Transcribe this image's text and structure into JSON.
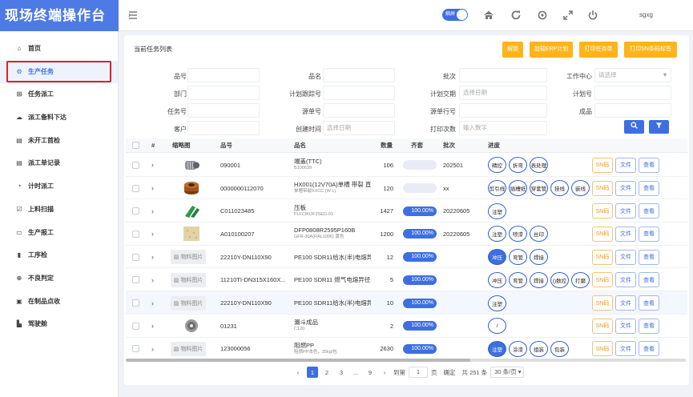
{
  "app": {
    "title": "现场终端操作台",
    "toggle_label": "触屏",
    "user": "sgxg"
  },
  "sidebar": {
    "items": [
      {
        "label": "首页",
        "icon": "home-icon",
        "glyph": "⌂"
      },
      {
        "label": "生产任务",
        "icon": "gears-icon",
        "glyph": "⚙"
      },
      {
        "label": "任务派工",
        "icon": "org-chart-icon",
        "glyph": "⊞"
      },
      {
        "label": "派工备料下达",
        "icon": "cloud-download-icon",
        "glyph": "☁"
      },
      {
        "label": "未开工首检",
        "icon": "id-card-icon",
        "glyph": "▤"
      },
      {
        "label": "派工单记录",
        "icon": "id-card-icon",
        "glyph": "▤"
      },
      {
        "label": "计时派工",
        "icon": "clock-icon",
        "glyph": "◔"
      },
      {
        "label": "上料扫描",
        "icon": "check-square-icon",
        "glyph": "☑"
      },
      {
        "label": "生产报工",
        "icon": "file-icon",
        "glyph": "▭"
      },
      {
        "label": "工序检",
        "icon": "database-icon",
        "glyph": "▮"
      },
      {
        "label": "不良判定",
        "icon": "search-plus-icon",
        "glyph": "⊕"
      },
      {
        "label": "在制品点收",
        "icon": "inbox-icon",
        "glyph": "▣"
      },
      {
        "label": "驾驶舱",
        "icon": "chart-icon",
        "glyph": "▙"
      }
    ]
  },
  "panel": {
    "title": "当前任务列表",
    "buttons": [
      "解锁",
      "加载ERP计划",
      "打印任务单",
      "打印SN条码标签"
    ],
    "filters": {
      "pinhao": "品号",
      "pinming": "品名",
      "pici": "批次",
      "gongzuozhongxin": "工作中心",
      "gongzuozhongxin_ph": "请选择",
      "bumen": "部门",
      "jihuagenzonghao": "计划跟踪号",
      "jihuajiaoqi": "计划交期",
      "jihuajiaoqi_ph": "选择日期",
      "jihuahao": "计划号",
      "renwuhao": "任务号",
      "yuandanhao": "源单号",
      "yuandanhanghao": "源单行号",
      "chengpin": "成品",
      "kehu": "客户",
      "chuangjianshijian": "创建时间",
      "chuangjianshijian_ph": "选择日期",
      "dayincishu": "打印次数",
      "dayincishu_ph": "输入数字"
    }
  },
  "table": {
    "headers": [
      "#",
      "缩略图",
      "品号",
      "品名",
      "数量",
      "齐套",
      "批次",
      "进度"
    ],
    "rows": [
      {
        "code": "090001",
        "name": "端盖(TTC)",
        "sub": "B100639",
        "qty": "106",
        "kit": "",
        "kit_pct": 0,
        "batch": "202501",
        "steps": [
          {
            "t": "精控",
            "d": false
          },
          {
            "t": "折弯",
            "d": false
          },
          {
            "t": "表处理",
            "d": false
          }
        ],
        "img": "motor",
        "ph": ""
      },
      {
        "code": "0000000112070",
        "name": "HX001(12V70A)单槽 带裂 直月",
        "sub": "单槽带裂XXCC (W L)",
        "qty": "120",
        "kit": "",
        "kit_pct": 0,
        "batch": "xx",
        "steps": [
          {
            "t": "剪引线",
            "d": false
          },
          {
            "t": "插槽纸",
            "d": false
          },
          {
            "t": "穿套管",
            "d": false
          },
          {
            "t": "挂线",
            "d": false
          },
          {
            "t": "嵌线",
            "d": false
          }
        ],
        "img": "coil",
        "ph": ""
      },
      {
        "code": "C011023485",
        "name": "压板",
        "sub": "FLFCIKOF2SED-01",
        "qty": "1427",
        "kit": "100.00%",
        "kit_pct": 100,
        "batch": "20220605",
        "steps": [
          {
            "t": "注塑",
            "d": false
          }
        ],
        "img": "green",
        "ph": ""
      },
      {
        "code": "A010100207",
        "name": "DFP0808R2595P160B",
        "sub": "GFR-30A(RAL1006) 黄色",
        "qty": "1200",
        "kit": "100.00%",
        "kit_pct": 100,
        "batch": "20220605",
        "steps": [
          {
            "t": "注塑",
            "d": false
          },
          {
            "t": "喷漆",
            "d": false
          },
          {
            "t": "丝印",
            "d": false
          }
        ],
        "img": "beige",
        "ph": ""
      },
      {
        "code": "22210Y-DN110X90",
        "name": "PE100 SDR11给水(半)电熔异径",
        "sub": "",
        "qty": "12",
        "kit": "100.00%",
        "kit_pct": 100,
        "batch": "",
        "steps": [
          {
            "t": "冲压",
            "d": true
          },
          {
            "t": "弯管",
            "d": false
          },
          {
            "t": "焊接",
            "d": false
          }
        ],
        "img": "",
        "ph": "物料图片"
      },
      {
        "code": "11210TI-DN315X160X...",
        "name": "PE100 SDR11 燃气电熔异径三通",
        "sub": "",
        "qty": "5",
        "kit": "100.00%",
        "kit_pct": 100,
        "batch": "",
        "steps": [
          {
            "t": "冲压",
            "d": false
          },
          {
            "t": "弯管",
            "d": false
          },
          {
            "t": "焊接",
            "d": false
          },
          {
            "t": "()数控",
            "d": false
          },
          {
            "t": "打磨",
            "d": false
          }
        ],
        "img": "",
        "ph": "物料图片"
      },
      {
        "code": "22210Y-DN110X90",
        "name": "PE100 SDR11给水(半)电熔异径",
        "sub": "",
        "qty": "10",
        "kit": "100.00%",
        "kit_pct": 100,
        "batch": "",
        "steps": [
          {
            "t": "注塑",
            "d": false
          }
        ],
        "img": "",
        "ph": "物料图片"
      },
      {
        "code": "01231",
        "name": "漏斗成品",
        "sub": "C120",
        "qty": "2",
        "kit": "100.00%",
        "kit_pct": 100,
        "batch": "",
        "steps": [
          {
            "t": "/",
            "d": false
          }
        ],
        "img": "gear",
        "ph": ""
      },
      {
        "code": "123000056",
        "name": "阻燃PP",
        "sub": "阻燃PP本色，25kg/包",
        "qty": "2630",
        "kit": "100.00%",
        "kit_pct": 100,
        "batch": "",
        "steps": [
          {
            "t": "注塑",
            "d": true
          },
          {
            "t": "涂漆",
            "d": false
          },
          {
            "t": "组装",
            "d": false
          },
          {
            "t": "包装",
            "d": false
          }
        ],
        "img": "",
        "ph": "物料图片"
      }
    ],
    "actions": {
      "sn": "SN码",
      "file": "文件",
      "view": "查看"
    }
  },
  "pager": {
    "pages": [
      "1",
      "2",
      "3",
      "...",
      "9"
    ],
    "goto_label": "到第",
    "goto_value": "1",
    "page_suffix": "页",
    "confirm": "确定",
    "total": "共 251 条",
    "per_page": "30 条/页"
  }
}
